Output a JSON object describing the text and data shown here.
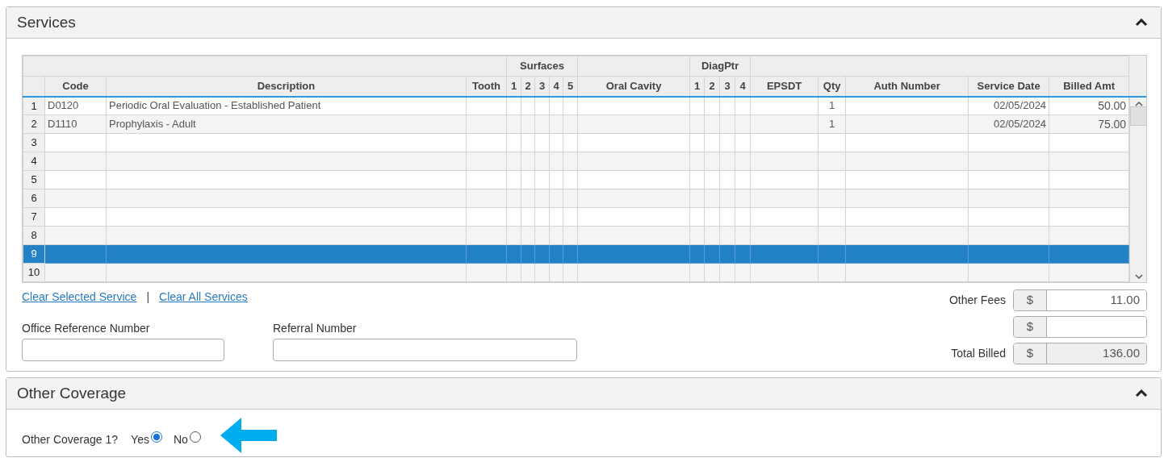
{
  "services": {
    "title": "Services",
    "expanded": true,
    "table": {
      "columns": [
        {
          "label": "Code"
        },
        {
          "label": "Description"
        },
        {
          "label": "Tooth"
        },
        {
          "label": "Surfaces",
          "children": [
            "1",
            "2",
            "3",
            "4",
            "5"
          ]
        },
        {
          "label": "Oral Cavity"
        },
        {
          "label": "DiagPtr",
          "children": [
            "1",
            "2",
            "3",
            "4"
          ]
        },
        {
          "label": "EPSDT"
        },
        {
          "label": "Qty"
        },
        {
          "label": "Auth Number"
        },
        {
          "label": "Service Date"
        },
        {
          "label": "Billed Amt"
        }
      ],
      "rows": [
        {
          "number": "1",
          "code": "D0120",
          "description": "Periodic Oral Evaluation - Established Patient",
          "qty": "1",
          "service_date": "02/05/2024",
          "billed_amt": "50.00",
          "selected": false
        },
        {
          "number": "2",
          "code": "D1110",
          "description": "Prophylaxis - Adult",
          "qty": "1",
          "service_date": "02/05/2024",
          "billed_amt": "75.00",
          "selected": false
        },
        {
          "number": "3",
          "selected": false
        },
        {
          "number": "4",
          "selected": false
        },
        {
          "number": "5",
          "selected": false
        },
        {
          "number": "6",
          "selected": false
        },
        {
          "number": "7",
          "selected": false
        },
        {
          "number": "8",
          "selected": false
        },
        {
          "number": "9",
          "selected": true
        },
        {
          "number": "10",
          "selected": false
        }
      ]
    },
    "links": [
      "Clear Selected Service",
      "Clear All Services"
    ],
    "link_separator": "|",
    "fields": [
      {
        "label": "Office Reference Number"
      },
      {
        "label": "Referral Number"
      }
    ],
    "fees": [
      {
        "label": "Other Fees",
        "currency": "$",
        "value": "11.00",
        "readonly": false
      },
      {
        "currency": "$",
        "readonly": false
      },
      {
        "label": "Total Billed",
        "currency": "$",
        "value": "136.00",
        "readonly": true
      }
    ]
  },
  "other_coverage": {
    "title": "Other Coverage",
    "expanded": true,
    "question": "Other Coverage 1?",
    "options": [
      {
        "label": "Yes",
        "selected": true
      },
      {
        "label": "No",
        "selected": false
      }
    ]
  }
}
